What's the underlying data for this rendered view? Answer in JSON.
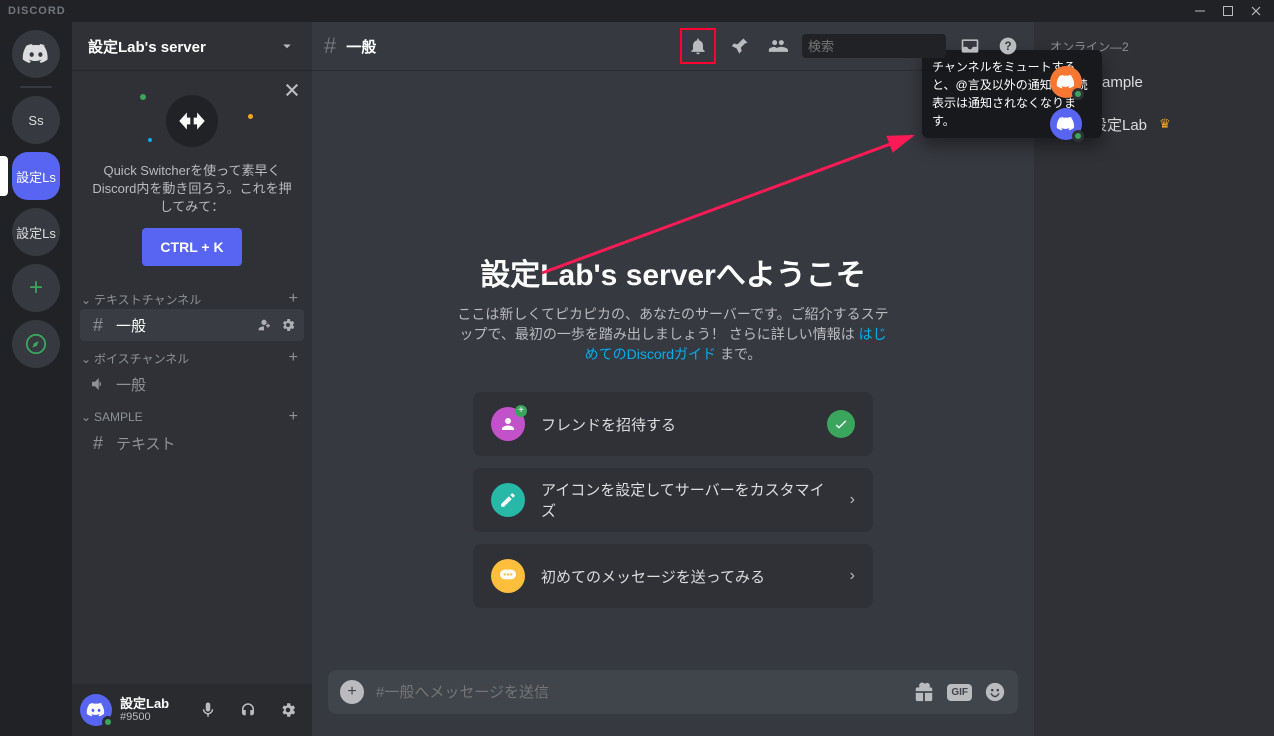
{
  "titlebar": {
    "brand": "DISCORD"
  },
  "server": {
    "name": "設定Lab's server"
  },
  "quickswitcher": {
    "text": "Quick Switcherを使って素早くDiscord内を動き回ろう。これを押してみて：",
    "key": "CTRL + K"
  },
  "categories": {
    "text": {
      "label": "テキストチャンネル"
    },
    "voice": {
      "label": "ボイスチャンネル"
    },
    "sample": {
      "label": "SAMPLE"
    }
  },
  "channels": {
    "general_text": "一般",
    "general_voice": "一般",
    "sample_text": "テキスト"
  },
  "user": {
    "name": "設定Lab",
    "tag": "#9500"
  },
  "header": {
    "channel": "一般",
    "search_placeholder": "検索",
    "tooltip": "チャンネルをミュートすると、@言及以外の通知と未読表示は通知されなくなります。"
  },
  "welcome": {
    "title": "設定Lab's serverへようこそ",
    "body_pre": "ここは新しくてピカピカの、あなたのサーバーです。ご紹介するステップで、最初の一歩を踏み出しましょう！ さらに詳しい情報は ",
    "link": "はじめてのDiscordガイド",
    "body_post": " まで。"
  },
  "cards": {
    "invite": "フレンドを招待する",
    "icon": "アイコンを設定してサーバーをカスタマイズ",
    "message": "初めてのメッセージを送ってみる"
  },
  "composer": {
    "placeholder": "#一般へメッセージを送信"
  },
  "members": {
    "heading": "オンライン—2",
    "m1": "Sample",
    "m2": "設定Lab"
  },
  "guilds": {
    "ss": "Ss",
    "sel": "設定Ls",
    "g3": "設定Ls"
  }
}
